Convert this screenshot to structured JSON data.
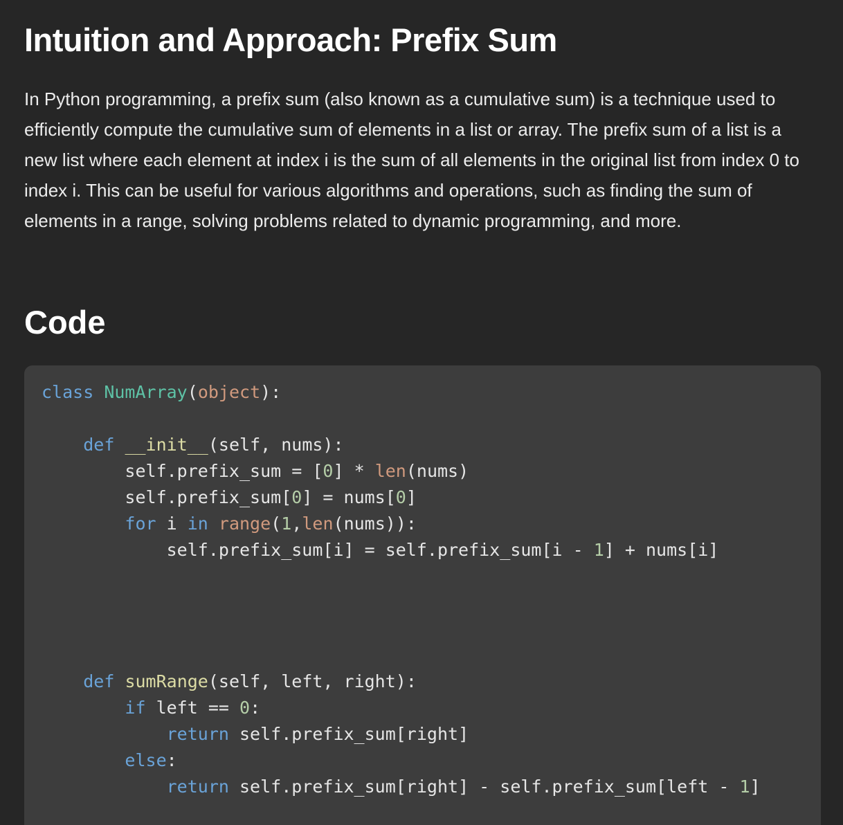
{
  "title": "Intuition and Approach: Prefix Sum",
  "paragraph": "In Python programming, a prefix sum (also known as a cumulative sum) is a technique used to efficiently compute the cumulative sum of elements in a list or array. The prefix sum of a list is a new list where each element at index i is the sum of all elements in the original list from index 0 to index i. This can be useful for various algorithms and operations, such as finding the sum of elements in a range, solving problems related to dynamic programming, and more.",
  "code_heading": "Code",
  "code": {
    "l1": {
      "kw": "class",
      "cls": "NumArray",
      "p1": "(",
      "bi": "object",
      "p2": "):"
    },
    "l2": {
      "indent": "    ",
      "kw": "def",
      "sp": " ",
      "fn": "__init__",
      "rest": "(self, nums):"
    },
    "l3": {
      "indent": "        ",
      "a": "self.prefix_sum = [",
      "n": "0",
      "b": "] * ",
      "bi": "len",
      "c": "(nums)"
    },
    "l4": {
      "indent": "        ",
      "a": "self.prefix_sum[",
      "n1": "0",
      "b": "] = nums[",
      "n2": "0",
      "c": "]"
    },
    "l5": {
      "indent": "        ",
      "kw1": "for",
      "a": " i ",
      "kw2": "in",
      "sp": " ",
      "bi1": "range",
      "b": "(",
      "n": "1",
      "c": ",",
      "bi2": "len",
      "d": "(nums)):"
    },
    "l6": {
      "indent": "            ",
      "a": "self.prefix_sum[i] = self.prefix_sum[i - ",
      "n": "1",
      "b": "] + nums[i]"
    },
    "l7": {
      "indent": "    ",
      "kw": "def",
      "sp": " ",
      "fn": "sumRange",
      "rest": "(self, left, right):"
    },
    "l8": {
      "indent": "        ",
      "kw": "if",
      "a": " left == ",
      "n": "0",
      "b": ":"
    },
    "l9": {
      "indent": "            ",
      "kw": "return",
      "a": " self.prefix_sum[right]"
    },
    "l10": {
      "indent": "        ",
      "kw": "else",
      "a": ":"
    },
    "l11": {
      "indent": "            ",
      "kw": "return",
      "a": " self.prefix_sum[right] - self.prefix_sum[left - ",
      "n": "1",
      "b": "]"
    }
  }
}
